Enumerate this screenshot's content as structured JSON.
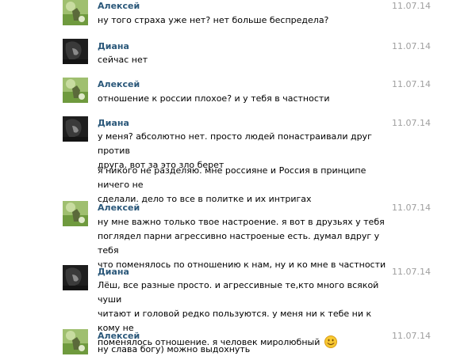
{
  "messages": [
    {
      "author": "Алексей",
      "date": "11.07.14",
      "lines": [
        "ну того страха уже нет? нет больше беспредела?"
      ]
    },
    {
      "author": "Диана",
      "date": "11.07.14",
      "lines": [
        "сейчас нет"
      ]
    },
    {
      "author": "Алексей",
      "date": "11.07.14",
      "lines": [
        "отношение к россии плохое? и у тебя в частности"
      ]
    },
    {
      "author": "Диана",
      "date": "11.07.14",
      "lines": [
        "у меня? абсолютно нет. просто людей понастраивали друг против",
        "друга. вот за это зло берет"
      ],
      "lines2": [
        "я никого не разделяю. мне россияне и Россия в принципе ничего не",
        "сделали. дело то все в политке и их интригах"
      ]
    },
    {
      "author": "Алексей",
      "date": "11.07.14",
      "lines": [
        "ну мне важно только твое настроение. я вот в друзьях у тебя",
        "поглядел парни агрессивно настроеные есть. думал вдруг у тебя",
        "что поменялось по отношению к нам, ну и ко мне в частности"
      ]
    },
    {
      "author": "Диана",
      "date": "11.07.14",
      "lines": [
        "Лёш, все разные просто. и агрессивные те,кто много всякой чуши",
        "читают и головой редко пользуются. у меня ни к тебе ни к кому не",
        "поменялось отношение. я человек миролюбный"
      ]
    },
    {
      "author": "Алексей",
      "date": "11.07.14",
      "lines": [
        "ну слава богу) можно выдохнуть"
      ]
    }
  ],
  "icons": {
    "avatar_alexey": "avatar-alexey-photo",
    "avatar_diana": "avatar-diana-photo",
    "smile": "smiling-emoji-icon"
  },
  "colors": {
    "author_name": "#2b587a",
    "date": "#a0a0a0",
    "text": "#000000"
  }
}
